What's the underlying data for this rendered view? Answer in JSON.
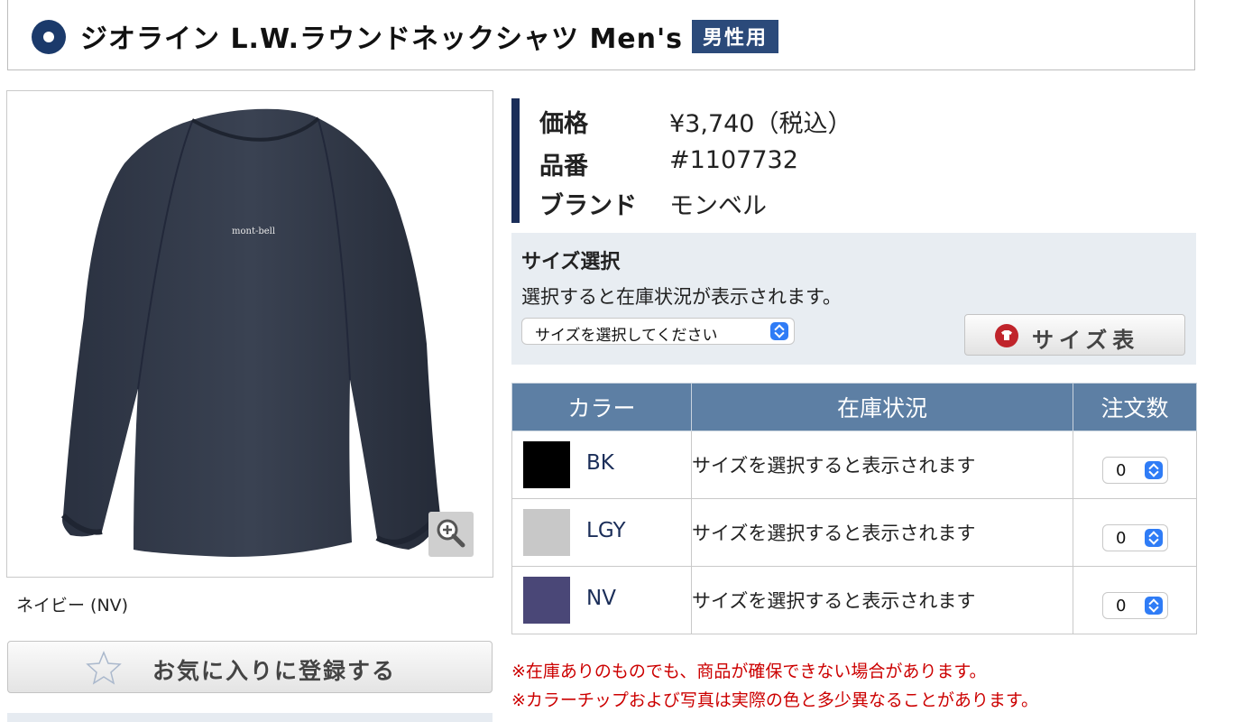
{
  "title": {
    "text": "ジオライン L.W.ラウンドネックシャツ Men's",
    "badge": "男性用"
  },
  "product_image": {
    "logo": "mont-bell",
    "caption": "ネイビー (NV)"
  },
  "favorite_button": {
    "label": "お気に入りに登録する"
  },
  "info": {
    "price_label": "価格",
    "price_value": "¥3,740（税込）",
    "code_label": "品番",
    "code_value": "#1107732",
    "brand_label": "ブランド",
    "brand_value": "モンベル"
  },
  "size_select": {
    "title": "サイズ選択",
    "description": "選択すると在庫状況が表示されます。",
    "selected": "サイズを選択してください",
    "chart_button": "サイズ表"
  },
  "color_table": {
    "headers": [
      "カラー",
      "在庫状況",
      "注文数"
    ],
    "rows": [
      {
        "swatch": "#000000",
        "name": "BK",
        "stock": "サイズを選択すると表示されます",
        "qty": "0"
      },
      {
        "swatch": "#c8c8c8",
        "name": "LGY",
        "stock": "サイズを選択すると表示されます",
        "qty": "0"
      },
      {
        "swatch": "#4a4777",
        "name": "NV",
        "stock": "サイズを選択すると表示されます",
        "qty": "0"
      }
    ]
  },
  "notes": [
    "※在庫ありのものでも、商品が確保できない場合があります。",
    "※カラーチップおよび写真は実際の色と多少異なることがあります。"
  ],
  "colors": {
    "brand_navy": "#1b2e59",
    "table_header": "#5d7fa4",
    "note_red": "#cc0000"
  }
}
